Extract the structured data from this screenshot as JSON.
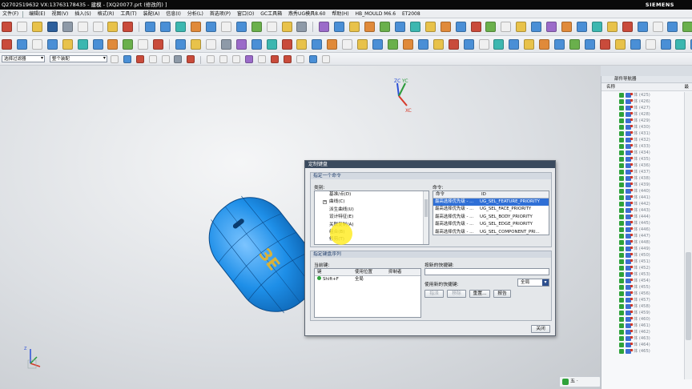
{
  "window": {
    "title": "Q2702519632  VX:13763178435 - 建模 - [XQ20077.prt  (修改的) ]",
    "brand": "SIEMENS"
  },
  "menu": [
    "文件(F)",
    "编辑(E)",
    "视图(V)",
    "插入(S)",
    "格式(R)",
    "工具(T)",
    "装配(A)",
    "信息(I)",
    "分析(L)",
    "首选项(P)",
    "窗口(O)",
    "GC工具箱",
    "燕秀UG模具8.60",
    "帮助(H)",
    "HB_MOULD M6.6",
    "ET2008"
  ],
  "filters": {
    "selection_filter": "选择过滤器",
    "assembly_scope": "整个装配"
  },
  "viewport": {
    "triad_labels": [
      "ZC",
      "YC",
      "XC"
    ],
    "part_text": "ЗЕ",
    "small_triad": "Z"
  },
  "navigator": {
    "title": "部件导航器",
    "col_name": "名称",
    "col_right": "最",
    "rows": [
      "体 (425)",
      "体 (426)",
      "体 (427)",
      "体 (428)",
      "体 (429)",
      "体 (430)",
      "体 (431)",
      "体 (432)",
      "体 (433)",
      "体 (434)",
      "体 (435)",
      "体 (436)",
      "体 (437)",
      "体 (438)",
      "体 (439)",
      "体 (440)",
      "体 (441)",
      "体 (442)",
      "体 (443)",
      "体 (444)",
      "体 (445)",
      "体 (446)",
      "体 (447)",
      "体 (448)",
      "体 (449)",
      "体 (450)",
      "体 (451)",
      "体 (452)",
      "体 (453)",
      "体 (454)",
      "体 (455)",
      "体 (456)",
      "体 (457)",
      "体 (458)",
      "体 (459)",
      "体 (460)",
      "体 (461)",
      "体 (462)",
      "体 (463)",
      "体 (464)",
      "体 (465)"
    ]
  },
  "dialog": {
    "title": "定制键盘",
    "section_command": "指定一个命令",
    "label_category": "类别:",
    "categories": [
      {
        "expander": "",
        "label": "基准/点(D)"
      },
      {
        "expander": "+",
        "label": "曲线(C)"
      },
      {
        "expander": "",
        "label": "派生曲线(U)"
      },
      {
        "expander": "",
        "label": "设计特征(E)"
      },
      {
        "expander": "",
        "label": "关联复制(A)"
      },
      {
        "expander": "",
        "label": "组合(B)"
      },
      {
        "expander": "",
        "label": "修剪(T)"
      }
    ],
    "label_commands": "命令:",
    "commands_headers": [
      "命令",
      "ID"
    ],
    "commands": [
      {
        "cmd": "最高选择优先级 - ...",
        "id": "UG_SEL_FEATURE_PRIORITY"
      },
      {
        "cmd": "最高选择优先级 - ...",
        "id": "UG_SEL_FACE_PRIORITY"
      },
      {
        "cmd": "最高选择优先级 - ...",
        "id": "UG_SEL_BODY_PRIORITY"
      },
      {
        "cmd": "最高选择优先级 - ...",
        "id": "UG_SEL_EDGE_PRIORITY"
      },
      {
        "cmd": "最高选择优先级 - ...",
        "id": "UG_SEL_COMPONENT_PRI..."
      }
    ],
    "section_sequence": "指定键盘序列",
    "label_current_keys": "当前键:",
    "keys_headers": [
      "键",
      "使用位置",
      "抑制者"
    ],
    "keys_rows": [
      {
        "key": "Shift+F",
        "where": "全局",
        "suppressed": ""
      }
    ],
    "label_new_shortcut": "按新的快捷键:",
    "label_used_by": "使用新的快捷键:",
    "scope_value": "全局",
    "btn_assign": "指派",
    "btn_remove": "移除",
    "btn_reset": "重置...",
    "btn_report": "报告",
    "btn_close": "关闭"
  },
  "taskbar": {
    "text": "五 ·"
  }
}
